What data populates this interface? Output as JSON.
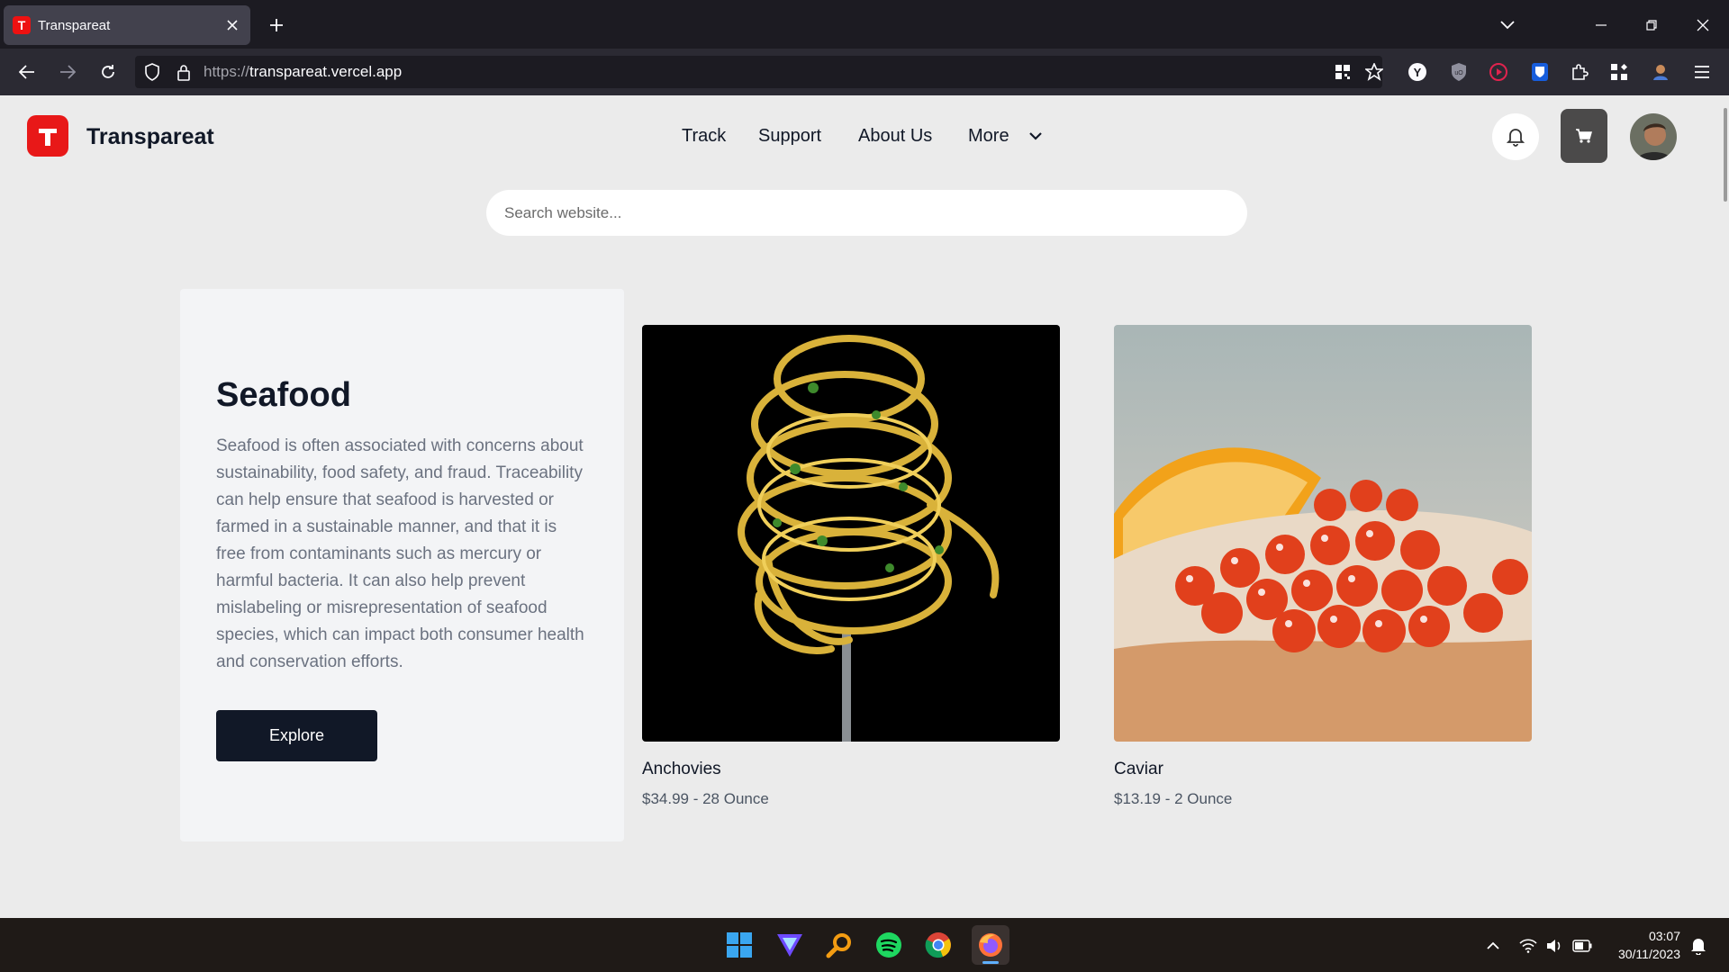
{
  "browser": {
    "tab_title": "Transpareat",
    "tab_favicon_letter": "T",
    "url_protocol": "https://",
    "url_host": "transpareat.vercel.app"
  },
  "site": {
    "logo_letter": "T",
    "brand": "Transpareat",
    "nav": [
      "Track",
      "Support",
      "About Us",
      "More"
    ],
    "search_placeholder": "Search website..."
  },
  "category": {
    "title": "Seafood",
    "description": "Seafood is often associated with concerns about sustainability, food safety, and fraud. Traceability can help ensure that seafood is harvested or farmed in a sustainable manner, and that it is free from contaminants such as mercury or harmful bacteria. It can also help prevent mislabeling or misrepresentation of seafood species, which can impact both consumer health and conservation efforts.",
    "button": "Explore"
  },
  "products": [
    {
      "name": "Anchovies",
      "price": "$34.99 - 28 Ounce",
      "image": "spaghetti-on-fork"
    },
    {
      "name": "Caviar",
      "price": "$13.19 - 2 Ounce",
      "image": "caviar-on-bread"
    }
  ],
  "taskbar": {
    "time": "03:07",
    "date": "30/11/2023"
  },
  "colors": {
    "brand_red": "#e81818",
    "page_bg": "#ebebeb",
    "button_dark": "#111827"
  }
}
